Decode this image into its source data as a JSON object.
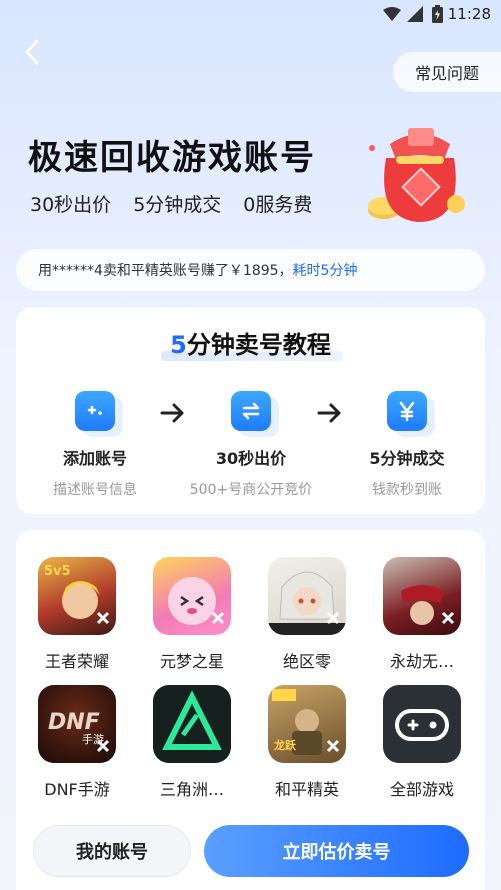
{
  "status_bar": {
    "time": "11:28"
  },
  "header": {
    "faq_label": "常见问题"
  },
  "hero": {
    "title": "极速回收游戏账号",
    "tags": [
      "30秒出价",
      "5分钟成交",
      "0服务费"
    ]
  },
  "ticker": {
    "text": "用******4卖和平精英账号赚了￥1895，",
    "accent": "耗时5分钟"
  },
  "tutorial": {
    "title_num": "5",
    "title_rest": "分钟卖号教程",
    "steps": [
      {
        "label": "添加账号",
        "sub": "描述账号信息",
        "icon": "add-account-icon"
      },
      {
        "label": "30秒出价",
        "sub": "500+号商公开竞价",
        "icon": "exchange-icon"
      },
      {
        "label": "5分钟成交",
        "sub": "钱款秒到账",
        "icon": "yen-icon"
      }
    ]
  },
  "games": [
    {
      "name": "王者荣耀",
      "icon": "honor-of-kings-icon",
      "color": "#b23a2a"
    },
    {
      "name": "元梦之星",
      "icon": "yuanmeng-star-icon",
      "color": "#f27bb5"
    },
    {
      "name": "绝区零",
      "icon": "zenless-zone-zero-icon",
      "color": "#e8e1d6"
    },
    {
      "name": "永劫无…",
      "icon": "naraka-icon",
      "color": "#7a1d22"
    },
    {
      "name": "DNF手游",
      "icon": "dnf-mobile-icon",
      "color": "#2b1310"
    },
    {
      "name": "三角洲…",
      "icon": "delta-force-icon",
      "color": "#1a2b2a"
    },
    {
      "name": "和平精英",
      "icon": "peacekeeper-elite-icon",
      "color": "#8a6a3a"
    },
    {
      "name": "全部游戏",
      "icon": "all-games-gamepad-icon",
      "color": "#2b2f36"
    }
  ],
  "bottom": {
    "my_account_label": "我的账号",
    "estimate_label": "立即估价卖号"
  },
  "colors": {
    "accent": "#1e6bff",
    "button_gradient_start": "#5aa0ff"
  }
}
